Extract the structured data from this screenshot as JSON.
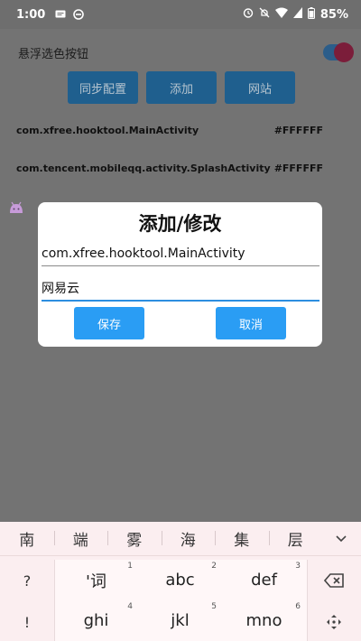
{
  "status_bar": {
    "time": "1:00",
    "battery_percent": "85%",
    "icons_left": [
      "message-icon",
      "sync-icon"
    ],
    "icons_right": [
      "alarm-icon",
      "mute-icon",
      "wifi-icon",
      "signal-icon",
      "battery-icon"
    ]
  },
  "app": {
    "float_toggle_label": "悬浮选色按钮",
    "float_toggle_on": true,
    "buttons": {
      "sync": "同步配置",
      "add": "添加",
      "site": "网站"
    },
    "list": [
      {
        "activity": "com.xfree.hooktool.MainActivity",
        "color": "#FFFFFF"
      },
      {
        "activity": "com.tencent.mobileqq.activity.SplashActivity",
        "color": "#FFFFFF"
      }
    ]
  },
  "dialog": {
    "title": "添加/修改",
    "activity_value": "com.xfree.hooktool.MainActivity",
    "name_value": "网易云",
    "save_label": "保存",
    "cancel_label": "取消"
  },
  "keyboard": {
    "candidates": [
      "南",
      "端",
      "雾",
      "海",
      "集",
      "层"
    ],
    "left_keys": [
      "?",
      "!"
    ],
    "keys": [
      {
        "label": "'词",
        "num": "1"
      },
      {
        "label": "abc",
        "num": "2"
      },
      {
        "label": "def",
        "num": "3"
      },
      {
        "label": "ghi",
        "num": "4"
      },
      {
        "label": "jkl",
        "num": "5"
      },
      {
        "label": "mno",
        "num": "6"
      }
    ]
  },
  "colors": {
    "accent": "#2a9df4",
    "scrim": "#6e6e6e",
    "keyboard_bg": "#fbeef0"
  }
}
